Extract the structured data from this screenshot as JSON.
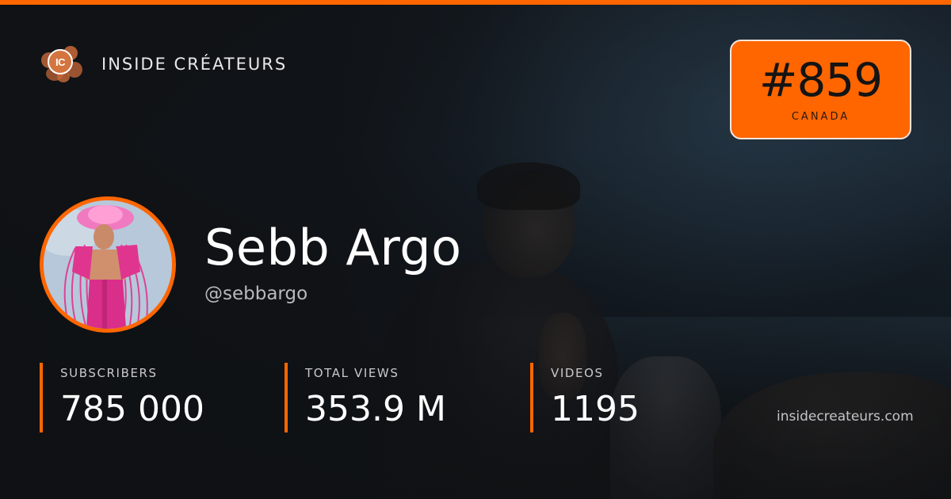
{
  "brand": {
    "name": "INSIDE CRÉATEURS",
    "logo_text": "IC",
    "logo_icon": "ic-logo-icon",
    "accent_color": "#ff6600"
  },
  "rank": {
    "number": "#859",
    "country": "CANADA"
  },
  "profile": {
    "name": "Sebb Argo",
    "handle": "@sebbargo",
    "avatar_icon": "avatar-photo"
  },
  "stats": [
    {
      "label": "SUBSCRIBERS",
      "value": "785 000"
    },
    {
      "label": "TOTAL VIEWS",
      "value": "353.9 M"
    },
    {
      "label": "VIDEOS",
      "value": "1195"
    }
  ],
  "footer": {
    "site_url": "insidecreateurs.com"
  }
}
